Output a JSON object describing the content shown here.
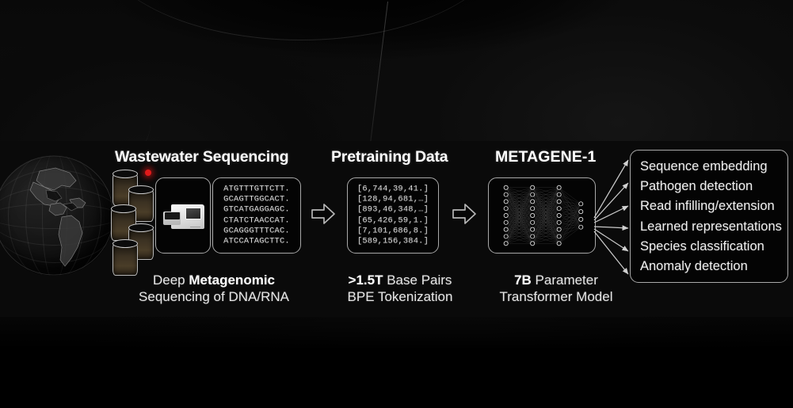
{
  "figure": {
    "stages": [
      {
        "id": "wastewater",
        "title": "Wastewater Sequencing",
        "caption_line1_plain": "Deep ",
        "caption_line1_bold": "Metagenomic",
        "caption_line2": "Sequencing of DNA/RNA",
        "dna_sequences": [
          "ATGTTTGTTCTT.",
          "GCAGTTGGCACT.",
          "GTCATGAGGAGC.",
          "CTATCTAACCAT.",
          "GCAGGGTTTCAC.",
          "ATCCATAGCTTC."
        ]
      },
      {
        "id": "pretraining",
        "title": "Pretraining Data",
        "caption_line1_bold": ">1.5T",
        "caption_line1_plain": " Base Pairs",
        "caption_line2": "BPE Tokenization",
        "token_arrays": [
          "[6,744,39,41.]",
          "[128,94,681,…]",
          "[893,46,348,…]",
          "[65,426,59,1.]",
          "[7,101,686,8.]",
          "[589,156,384.]"
        ]
      },
      {
        "id": "metagene",
        "title": "METAGENE-1",
        "caption_line1_bold": "7B",
        "caption_line1_plain": " Parameter",
        "caption_line2": "Transformer Model"
      }
    ],
    "outputs": [
      "Sequence embedding",
      "Pathogen detection",
      "Read infilling/extension",
      "Learned representations",
      "Species classification",
      "Anomaly detection"
    ],
    "icons": {
      "globe": "globe-icon",
      "vials": "sample-vials-icon",
      "indicator": "red-indicator-dot",
      "sequencer": "dna-sequencer-machine-icon",
      "arrow": "right-block-arrow-icon",
      "network": "neural-network-diagram"
    },
    "colors": {
      "panel_bg": "#0a0a0a",
      "card_border": "#a9a9a9",
      "text": "#f0f0f0",
      "mono_text": "#dcdcdc",
      "indicator": "#e11a1a",
      "vial_fill": "#4a3d28"
    },
    "network": {
      "layer_node_counts": [
        9,
        9,
        9,
        4
      ]
    }
  }
}
